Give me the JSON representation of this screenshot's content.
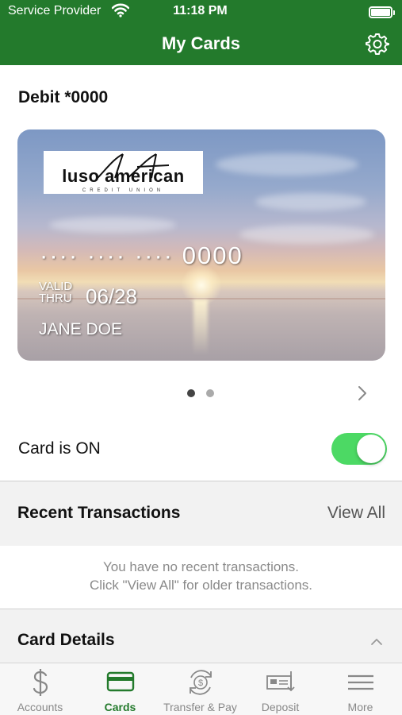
{
  "status_bar": {
    "carrier": "Service Provider",
    "time": "11:18 PM"
  },
  "header": {
    "title": "My Cards"
  },
  "card": {
    "title": "Debit *0000",
    "logo_text": "luso american",
    "logo_subtext": "CREDIT UNION",
    "number_masked": "···· ···· ···· 0000",
    "valid_label_1": "VALID",
    "valid_label_2": "THRU",
    "expiry": "06/28",
    "cardholder": "JANE DOE"
  },
  "pager": {
    "pages": 2,
    "current": 1
  },
  "card_toggle": {
    "label": "Card is ON",
    "on": true
  },
  "recent_transactions": {
    "title": "Recent Transactions",
    "view_all": "View All",
    "empty_line1": "You have no recent transactions.",
    "empty_line2": "Click \"View All\" for older transactions."
  },
  "card_details": {
    "title": "Card Details"
  },
  "tabbar": {
    "tabs": [
      {
        "label": "Accounts",
        "icon": "dollar-icon"
      },
      {
        "label": "Cards",
        "icon": "card-icon"
      },
      {
        "label": "Transfer & Pay",
        "icon": "transfer-icon"
      },
      {
        "label": "Deposit",
        "icon": "deposit-check-icon"
      },
      {
        "label": "More",
        "icon": "menu-icon"
      }
    ],
    "active_index": 1
  },
  "colors": {
    "brand_green": "#237a2c",
    "toggle_on": "#4cd964"
  }
}
